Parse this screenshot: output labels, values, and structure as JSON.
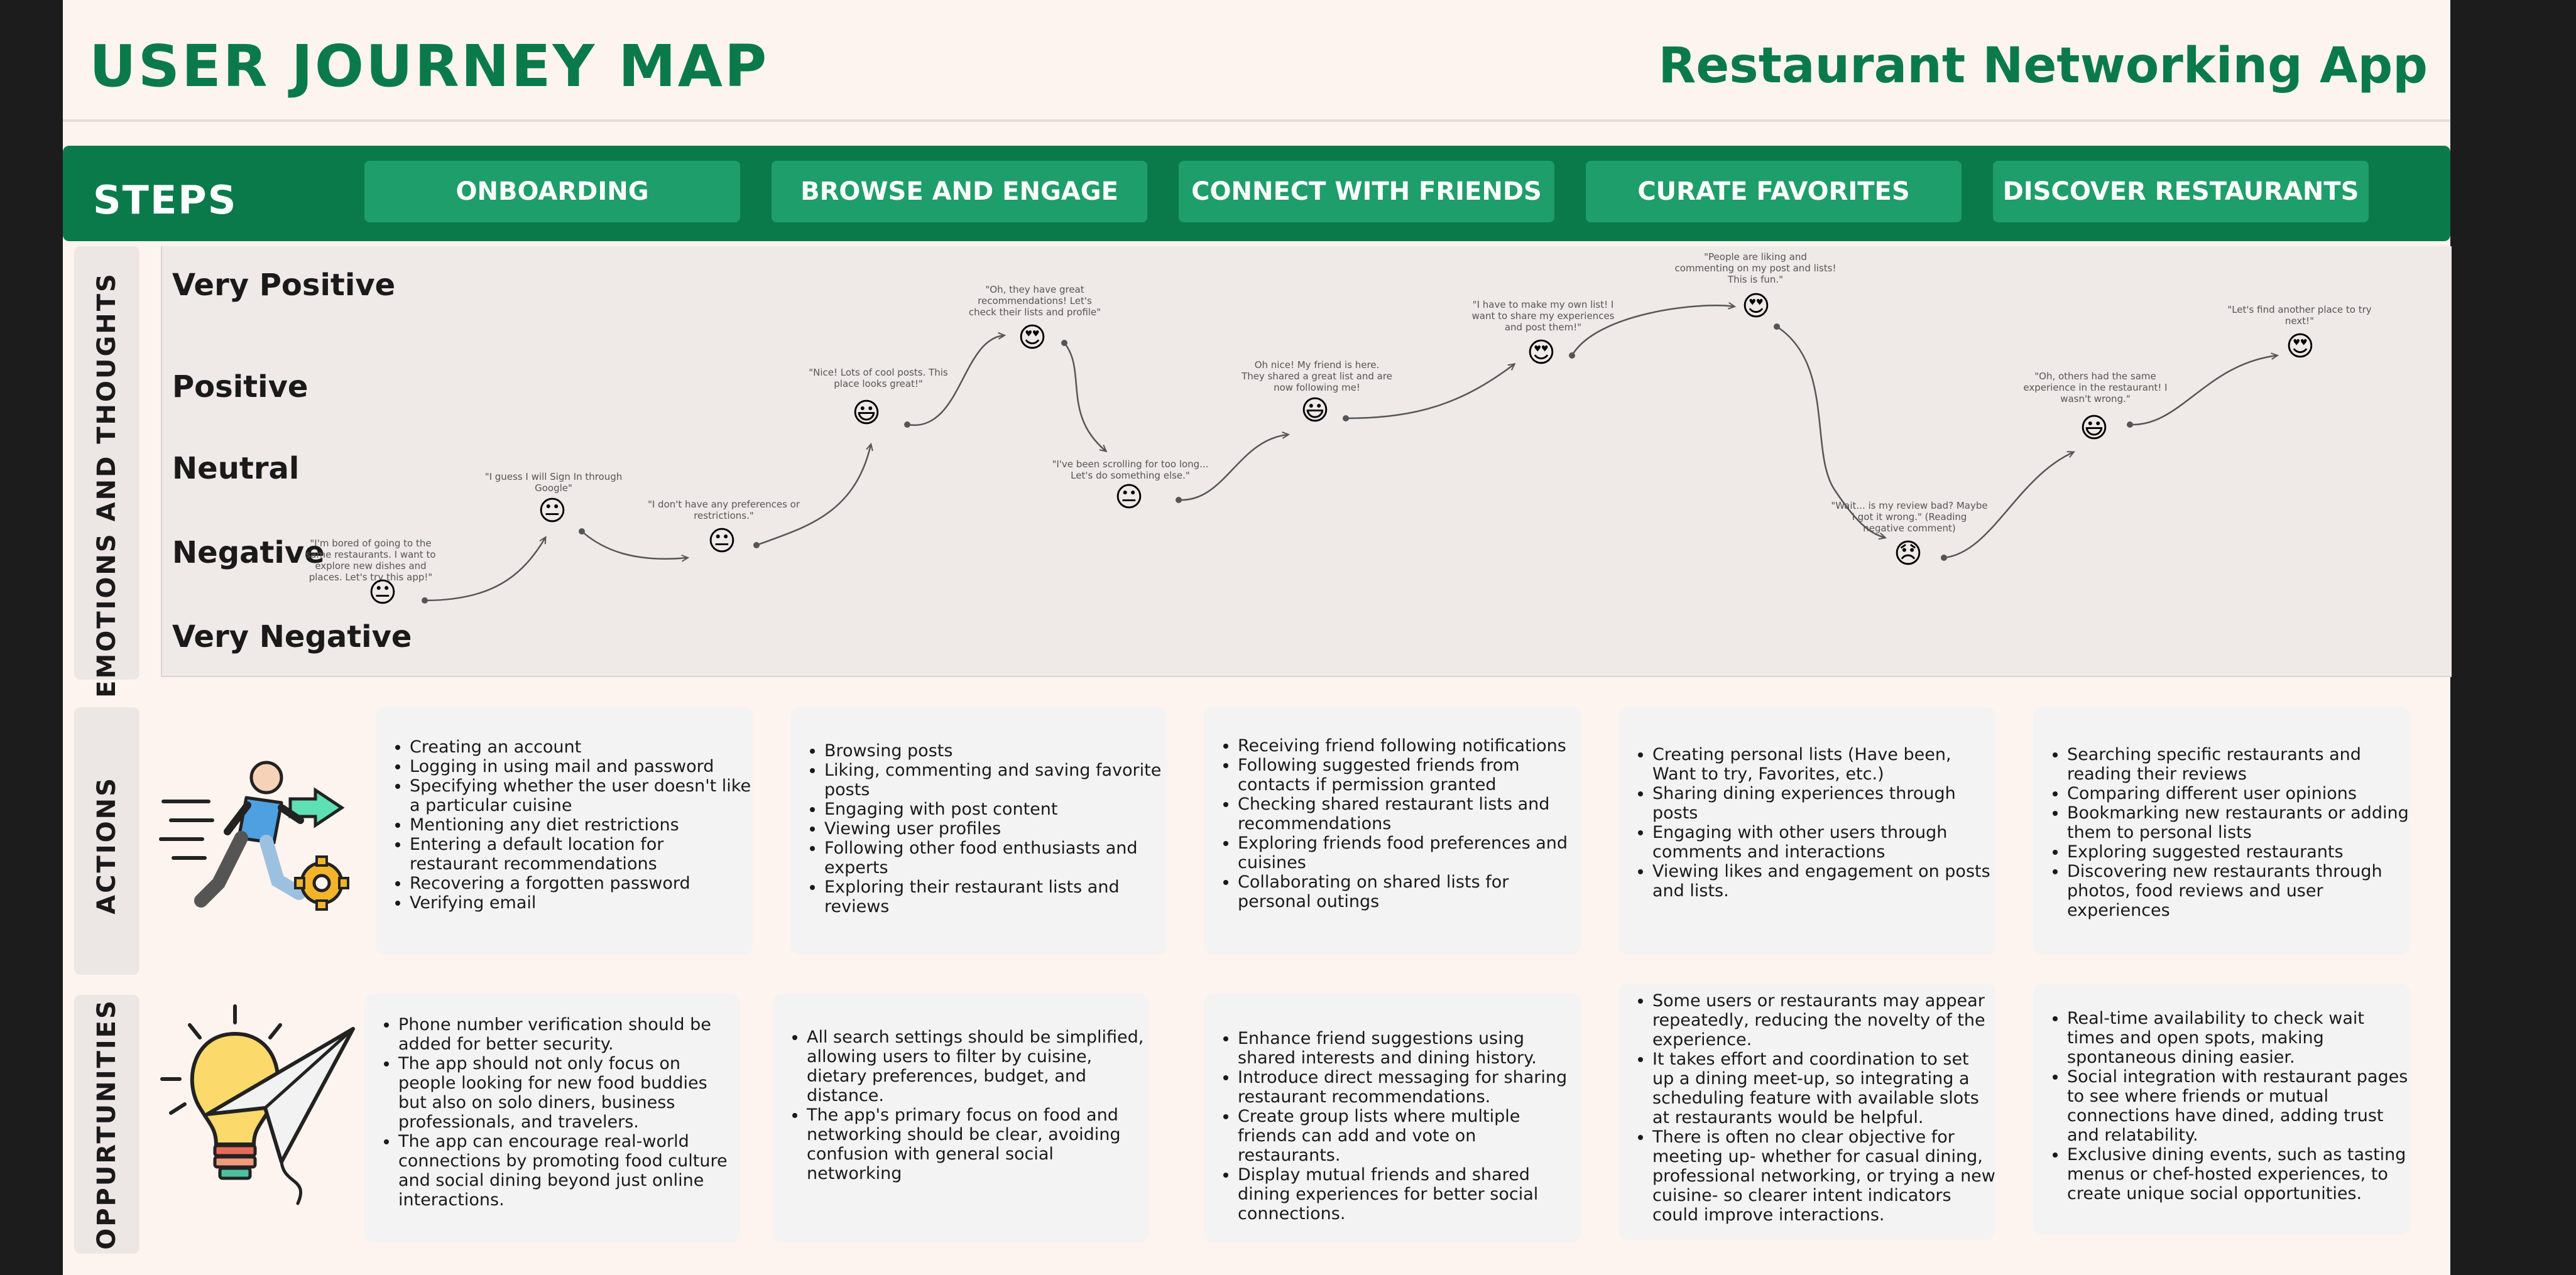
{
  "header": {
    "title": "USER JOURNEY MAP",
    "app_name": "Restaurant Networking App"
  },
  "steps": {
    "label": "STEPS",
    "stages": [
      "ONBOARDING",
      "BROWSE AND ENGAGE",
      "CONNECT WITH FRIENDS",
      "CURATE FAVORITES",
      "DISCOVER RESTAURANTS"
    ]
  },
  "sections": {
    "emotions": "EMOTIONS AND THOUGHTS",
    "actions": "ACTIONS",
    "opportunities": "OPPURTUNITIES"
  },
  "scale": [
    "Very Positive",
    "Positive",
    "Neutral",
    "Negative",
    "Very Negative"
  ],
  "journey_points": [
    {
      "emoji": "😐",
      "thought": "\"I'm bored of going to the same restaurants. I want to explore new dishes and places. Let's try this app!\""
    },
    {
      "emoji": "😐",
      "thought": "\"I guess I will Sign In through Google\""
    },
    {
      "emoji": "😐",
      "thought": "\"I don't have any preferences or restrictions.\""
    },
    {
      "emoji": "😃",
      "thought": "\"Nice! Lots of cool posts. This place looks great!\""
    },
    {
      "emoji": "😍",
      "thought": "\"Oh, they have great recommendations! Let's check their lists and profile\""
    },
    {
      "emoji": "😐",
      "thought": "\"I've been scrolling for too long... Let's do something else.\""
    },
    {
      "emoji": "😃",
      "thought": "Oh nice! My friend is here. They shared a great list and are now following me!"
    },
    {
      "emoji": "😍",
      "thought": "\"I have to make my own list! I want to share my experiences and post them!\""
    },
    {
      "emoji": "😍",
      "thought": "\"People are liking and commenting on my post and lists! This is fun.\""
    },
    {
      "emoji": "😞",
      "thought": "\"Wait... is my review bad? Maybe I got it wrong.\" (Reading negative comment)"
    },
    {
      "emoji": "😃",
      "thought": "\"Oh, others had the same experience in the restaurant! I wasn't wrong.\""
    },
    {
      "emoji": "😍",
      "thought": "\"Let's find another place to try next!\""
    }
  ],
  "actions": [
    [
      "Creating an account",
      "Logging in using mail and password",
      "Specifying whether the user doesn't like a particular cuisine",
      "Mentioning any diet restrictions",
      "Entering a default location for restaurant recommendations",
      "Recovering a forgotten password",
      "Verifying email"
    ],
    [
      "Browsing posts",
      "Liking, commenting and saving favorite posts",
      "Engaging with post content",
      "Viewing user profiles",
      "Following other food enthusiasts and experts",
      "Exploring their restaurant lists and reviews"
    ],
    [
      "Receiving friend following notifications",
      "Following suggested friends from contacts if permission granted",
      "Checking shared restaurant lists and recommendations",
      "Exploring friends food preferences and cuisines",
      "Collaborating on shared lists for personal outings"
    ],
    [
      "Creating personal lists (Have been, Want to try, Favorites, etc.)",
      "Sharing dining experiences through posts",
      "Engaging with other users through comments and interactions",
      "Viewing likes and engagement on posts and lists."
    ],
    [
      "Searching specific restaurants  and reading their reviews",
      "Comparing different  user opinions",
      "Bookmarking new restaurants or adding them to personal lists",
      "Exploring suggested restaurants",
      "Discovering new restaurants through photos, food reviews and user experiences"
    ]
  ],
  "opportunities": [
    [
      "Phone number verification should be added for better security.",
      "The app should not only focus on people looking for new food buddies but also on solo diners, business professionals, and travelers.",
      "The app can encourage real-world connections by promoting food culture and social dining beyond just online interactions."
    ],
    [
      "All search settings should be simplified, allowing users to filter by cuisine, dietary preferences, budget, and distance.",
      "The app's primary focus on food and networking should be clear, avoiding confusion with general social networking"
    ],
    [
      "Enhance friend suggestions using shared interests and dining history.",
      "Introduce direct messaging for sharing restaurant recommendations.",
      "Create group lists where multiple friends can add and vote on restaurants.",
      "Display mutual friends and shared dining experiences for better social connections."
    ],
    [
      "Some users or restaurants may appear repeatedly, reducing the novelty of the experience.",
      "It takes effort and coordination to set up a dining meet-up, so integrating a scheduling feature with available slots at restaurants would be helpful.",
      "There is often no clear objective for meeting up- whether for casual dining, professional networking, or trying a new cuisine- so clearer intent indicators could improve interactions."
    ],
    [
      "Real-time availability to check wait times and open spots, making spontaneous dining easier.",
      "Social integration with restaurant pages to see where friends or mutual connections have dined, adding trust and relatability.",
      "Exclusive dining events, such as tasting menus or chef-hosted experiences, to create unique social opportunities."
    ]
  ],
  "colors": {
    "brand_green": "#0b7a4b",
    "pill_green": "#1e9e6a",
    "board_bg": "#fdf4f0"
  }
}
